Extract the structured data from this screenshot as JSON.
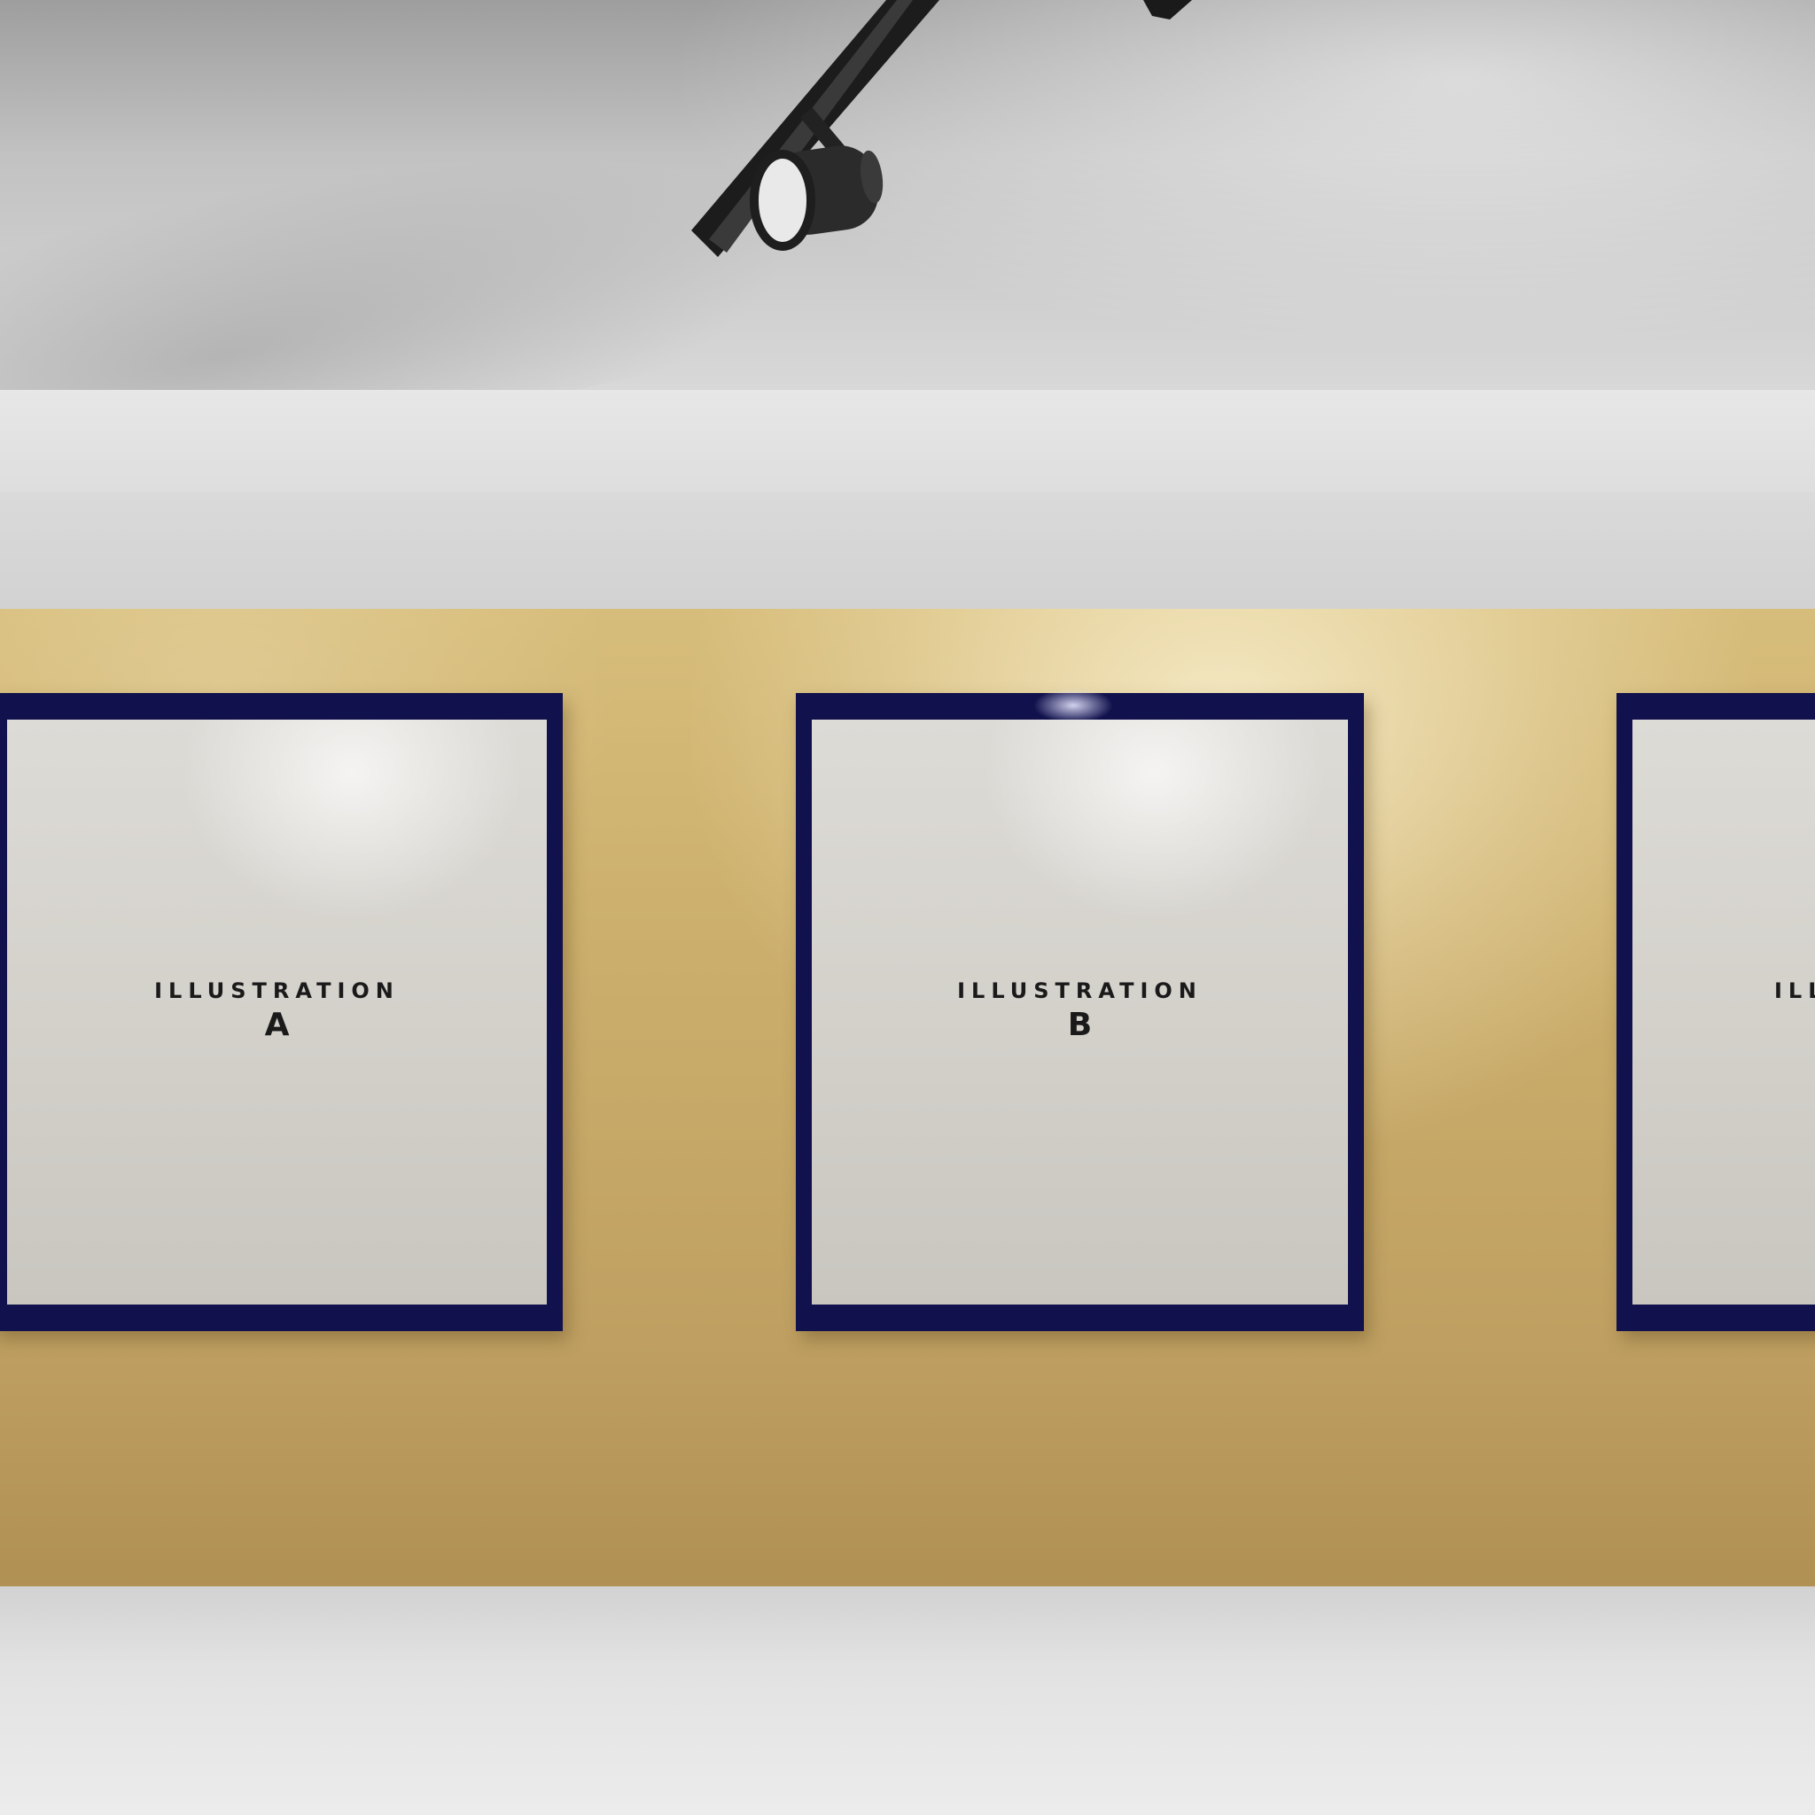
{
  "scene": {
    "colors": {
      "wall": "#cdb06d",
      "frame": "#11114d",
      "mat": "#d3d0ca",
      "ceiling": "#c2c2c2",
      "floor": "#e2e2e2",
      "fixture": "#2a2a2a"
    },
    "frames": [
      {
        "word": "ILLUSTRATION",
        "letter": "A"
      },
      {
        "word": "ILLUSTRATION",
        "letter": "B"
      },
      {
        "word": "ILL"
      }
    ]
  }
}
